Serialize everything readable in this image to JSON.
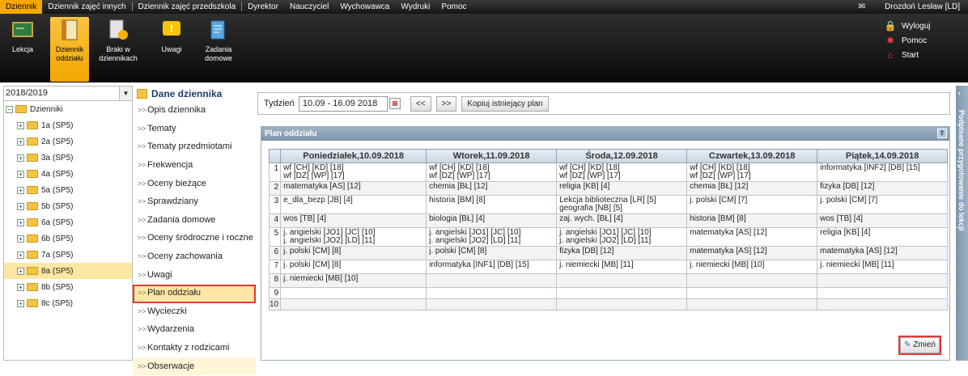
{
  "menu": {
    "tabs": [
      "Dziennik",
      "Dziennik zajęć innych",
      "Dziennik zajęć przedszkola",
      "Dyrektor",
      "Nauczyciel",
      "Wychowawca",
      "Wydruki",
      "Pomoc"
    ],
    "user": "Drozdoń Lesław [LD]"
  },
  "ribbon": {
    "buttons": [
      "Lekcja",
      "Dziennik oddziału",
      "Braki w dziennikach",
      "Uwagi",
      "Zadania domowe"
    ],
    "links": [
      "Wyloguj",
      "Pomoc",
      "Start"
    ]
  },
  "tree": {
    "year": "2018/2019",
    "root": "Dzienniki",
    "classes": [
      "1a (SP5)",
      "2a (SP5)",
      "3a (SP5)",
      "4a (SP5)",
      "5a (SP5)",
      "5b (SP5)",
      "6a (SP5)",
      "6b (SP5)",
      "7a (SP5)",
      "8a (SP5)",
      "8b (SP5)",
      "8c (SP5)"
    ]
  },
  "nav": {
    "title": "Dane dziennika",
    "items": [
      "Opis dziennika",
      "Tematy",
      "Tematy przedmiotami",
      "Frekwencja",
      "Oceny bieżące",
      "Sprawdziany",
      "Zadania domowe",
      "Oceny śródroczne i roczne",
      "Oceny zachowania",
      "Uwagi",
      "Plan oddziału",
      "Wycieczki",
      "Wydarzenia",
      "Kontakty z rodzicami",
      "Obserwacje"
    ]
  },
  "filter": {
    "label": "Tydzień",
    "value": "10.09 - 16.09 2018",
    "prev": "<<",
    "next": ">>",
    "copy": "Kopiuj istniejący plan"
  },
  "plan": {
    "title": "Plan oddziału",
    "days": [
      "Poniedziałek,10.09.2018",
      "Wtorek,11.09.2018",
      "Środa,12.09.2018",
      "Czwartek,13.09.2018",
      "Piątek,14.09.2018"
    ],
    "rows": [
      {
        "n": "1",
        "cells": [
          [
            "wf [CH] [KD] [18]",
            "wf [DZ] [WP] [17]"
          ],
          [
            "wf [CH] [KD] [18]",
            "wf [DZ] [WP] [17]"
          ],
          [
            "wf [CH] [KD] [18]",
            "wf [DZ] [WP] [17]"
          ],
          [
            "wf [CH] [KD] [18]",
            "wf [DZ] [WP] [17]"
          ],
          [
            "informatyka [INF2] [DB] [15]"
          ]
        ]
      },
      {
        "n": "2",
        "cells": [
          [
            "matematyka [AS] [12]"
          ],
          [
            "chemia [BŁ] [12]"
          ],
          [
            "religia [KB] [4]"
          ],
          [
            "chemia [BŁ] [12]"
          ],
          [
            "fizyka [DB] [12]"
          ]
        ]
      },
      {
        "n": "3",
        "cells": [
          [
            "e_dla_bezp [JB] [4]"
          ],
          [
            "historia [BM] [8]"
          ],
          [
            "Lekcja biblioteczna [LR] [5]",
            "geografia [NB] [5]"
          ],
          [
            "j. polski [CM] [7]"
          ],
          [
            "j. polski [CM] [7]"
          ]
        ]
      },
      {
        "n": "4",
        "cells": [
          [
            "wos [TB] [4]"
          ],
          [
            "biologia [BŁ] [4]"
          ],
          [
            "zaj. wych. [BŁ] [4]"
          ],
          [
            "historia [BM] [8]"
          ],
          [
            "wos [TB] [4]"
          ]
        ]
      },
      {
        "n": "5",
        "cells": [
          [
            "j. angielski [JO1] [JC] [10]",
            "j. angielski [JO2] [LD] [11]"
          ],
          [
            "j. angielski [JO1] [JC] [10]",
            "j. angielski [JO2] [LD] [11]"
          ],
          [
            "j. angielski [JO1] [JC] [10]",
            "j. angielski [JO2] [LD] [11]"
          ],
          [
            "matematyka [AS] [12]"
          ],
          [
            "religia [KB] [4]"
          ]
        ]
      },
      {
        "n": "6",
        "cells": [
          [
            "j. polski [CM] [8]"
          ],
          [
            "j. polski [CM] [8]"
          ],
          [
            "fizyka [DB] [12]"
          ],
          [
            "matematyka [AS] [12]"
          ],
          [
            "matematyka [AS] [12]"
          ]
        ]
      },
      {
        "n": "7",
        "cells": [
          [
            "j. polski [CM] [8]"
          ],
          [
            "informatyka [INF1] [DB] [15]"
          ],
          [
            "j. niemiecki [MB] [11]"
          ],
          [
            "j. niemiecki [MB] [10]"
          ],
          [
            "j. niemiecki [MB] [11]"
          ]
        ]
      },
      {
        "n": "8",
        "cells": [
          [
            "j. niemiecki [MB] [10]"
          ],
          [],
          [],
          [],
          []
        ]
      },
      {
        "n": "9",
        "cells": [
          [],
          [],
          [],
          [],
          []
        ]
      },
      {
        "n": "10",
        "cells": [
          [],
          [],
          [],
          [],
          []
        ]
      }
    ],
    "change": "Zmień"
  },
  "sidetab": "Podpisane przygotowanie do lekcji"
}
